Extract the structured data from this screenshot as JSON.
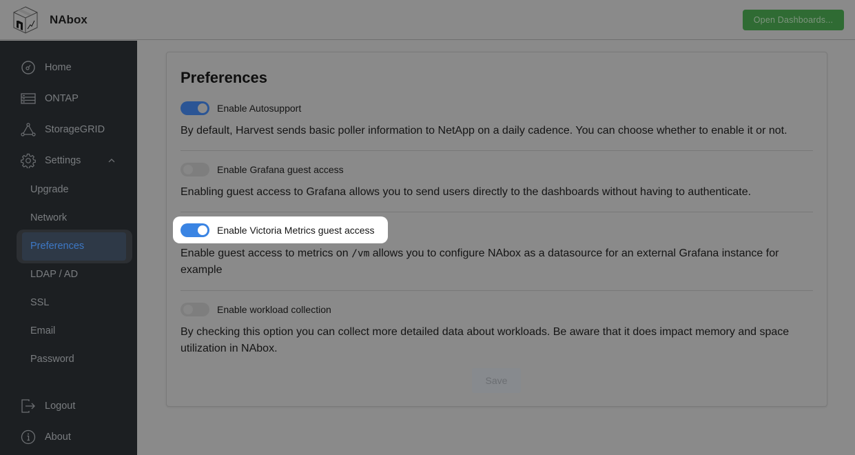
{
  "header": {
    "app_name": "NAbox",
    "logo_icon": "nabox-box-logo",
    "open_dashboards_label": "Open Dashboards..."
  },
  "sidebar": {
    "items": [
      {
        "label": "Home",
        "icon": "gauge-icon"
      },
      {
        "label": "ONTAP",
        "icon": "server-icon"
      },
      {
        "label": "StorageGRID",
        "icon": "triangle-nodes-icon"
      },
      {
        "label": "Settings",
        "icon": "gear-icon",
        "expanded": true
      }
    ],
    "settings_sub_items": [
      {
        "label": "Upgrade"
      },
      {
        "label": "Network"
      },
      {
        "label": "Preferences",
        "active": true
      },
      {
        "label": "LDAP / AD"
      },
      {
        "label": "SSL"
      },
      {
        "label": "Email"
      },
      {
        "label": "Password"
      }
    ],
    "bottom_items": [
      {
        "label": "Logout",
        "icon": "logout-icon"
      },
      {
        "label": "About",
        "icon": "info-icon"
      }
    ]
  },
  "main": {
    "title": "Preferences",
    "preferences": [
      {
        "label": "Enable Autosupport",
        "enabled": true,
        "description": "By default, Harvest sends basic poller information to NetApp on a daily cadence. You can choose whether to enable it or not."
      },
      {
        "label": "Enable Grafana guest access",
        "enabled": false,
        "description": "Enabling guest access to Grafana allows you to send users directly to the dashboards without having to authenticate."
      },
      {
        "label": "Enable Victoria Metrics guest access",
        "enabled": true,
        "highlighted": true,
        "description_before": "Enable guest access to metrics on ",
        "description_code": "/vm",
        "description_after": " allows you to configure NAbox as a datasource for an external Grafana instance for example"
      },
      {
        "label": "Enable workload collection",
        "enabled": false,
        "description": "By checking this option you can collect more detailed data about workloads. Be aware that it does impact memory and space utilization in NAbox."
      }
    ],
    "save_label": "Save",
    "save_disabled": true
  },
  "colors": {
    "accent_blue": "#3a84e3",
    "dashboard_button_green": "#2f6b33",
    "sidebar_bg": "#1c1f22",
    "active_item_text": "#3d78c5"
  }
}
